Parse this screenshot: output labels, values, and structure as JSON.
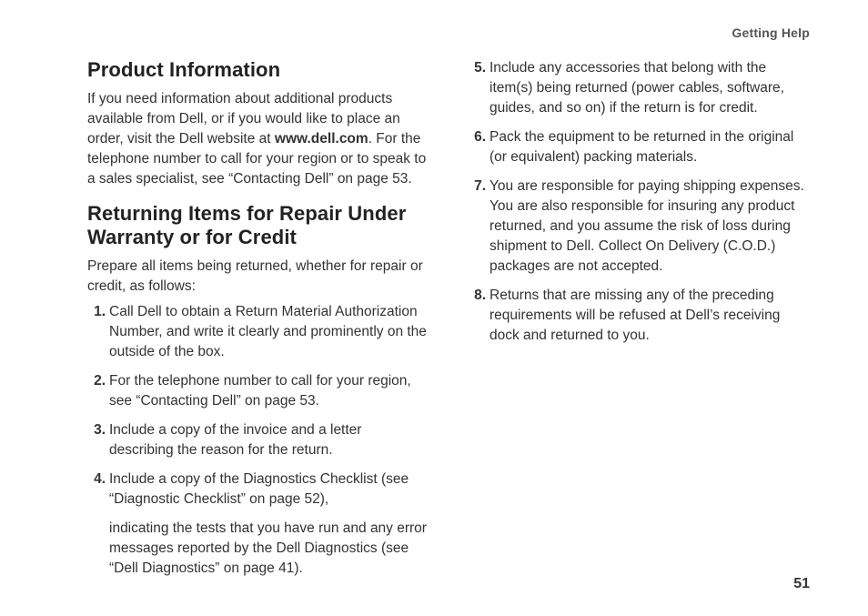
{
  "runningHead": "Getting Help",
  "pageNumber": "51",
  "section1": {
    "heading": "Product Information",
    "para_pre": "If you need information about additional products available from Dell, or if you would like to place an order, visit the Dell website at ",
    "para_bold": "www.dell.com",
    "para_post": ". For the telephone number to call for your region or to speak to a sales specialist, see “Contacting Dell” on page 53."
  },
  "section2": {
    "heading": "Returning Items for Repair Under Warranty or for Credit",
    "intro": "Prepare all items being returned, whether for repair or credit, as follows:",
    "items_col1": [
      "Call Dell to obtain a Return Material Authorization Number, and write it clearly and prominently on the outside of the box.",
      "For the telephone number to call for your region, see “Contacting Dell” on page 53.",
      "Include a copy of the invoice and a letter describing the reason for the return.",
      "Include a copy of the Diagnostics Checklist (see “Diagnostic Checklist” on page 52),"
    ],
    "col2_continuation": "indicating the tests that you have run and any error messages reported by the Dell Diagnostics (see “Dell Diagnostics” on page 41).",
    "items_col2": [
      "Include any accessories that belong with the item(s) being returned (power cables, software, guides, and so on) if the return is for credit.",
      "Pack the equipment to be returned in the original (or equivalent) packing materials.",
      "You are responsible for paying shipping expenses. You are also responsible for insuring any product returned, and you assume the risk of loss during shipment to Dell. Collect On Delivery (C.O.D.) packages are not accepted.",
      "Returns that are missing any of the preceding requirements will be refused at Dell’s receiving dock and returned to you."
    ]
  }
}
